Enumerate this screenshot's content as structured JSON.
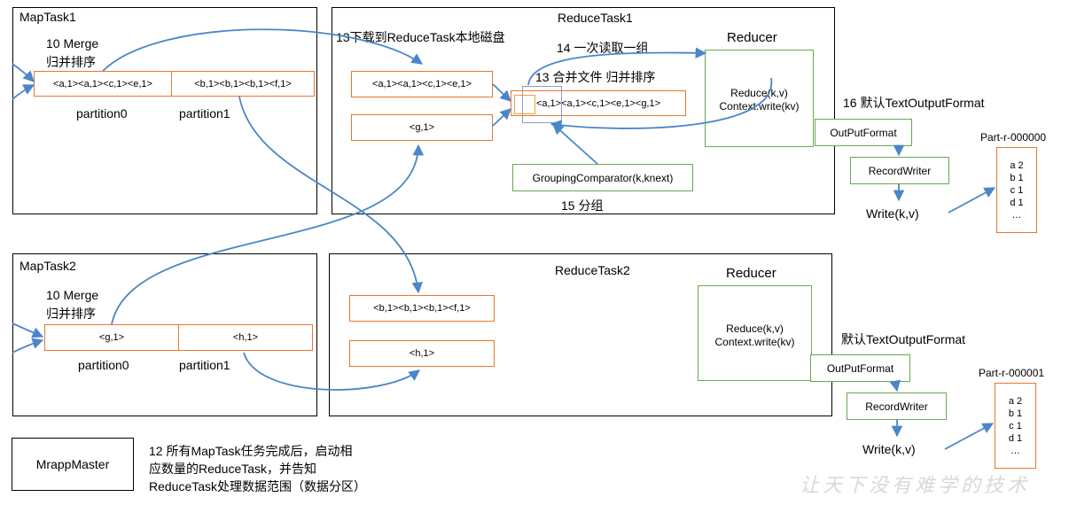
{
  "maptask1": {
    "title": "MapTask1",
    "merge_line1": "10 Merge",
    "merge_line2": "归并排序",
    "partition0_records": "<a,1><a,1><c,1><e,1>",
    "partition1_records": "<b,1><b,1><b,1><f,1>",
    "partition0_label": "partition0",
    "partition1_label": "partition1"
  },
  "maptask2": {
    "title": "MapTask2",
    "merge_line1": "10 Merge",
    "merge_line2": "归并排序",
    "partition0_records": "<g,1>",
    "partition1_records": "<h,1>",
    "partition0_label": "partition0",
    "partition1_label": "partition1"
  },
  "reducetask1": {
    "title": "ReduceTask1",
    "download_label": "13下载到ReduceTask本地磁盘",
    "read_group_label": "14 一次读取一组",
    "merge_label": "13 合并文件 归并排序",
    "input1": "<a,1><a,1><c,1><e,1>",
    "input2": "<g,1>",
    "merged": "<a,1><a,1><c,1><e,1><g,1>",
    "grouping_comparator": "GroupingComparator(k,knext)",
    "group_label": "15 分组",
    "reducer_title": "Reducer",
    "reduce_line1": "Reduce(k,v)",
    "reduce_line2": "Context.write(kv)",
    "output_format_label": "16 默认TextOutputFormat",
    "output_format": "OutPutFormat",
    "record_writer": "RecordWriter",
    "write": "Write(k,v)",
    "file_name": "Part-r-000000",
    "file_lines": [
      "a 2",
      "b 1",
      "c 1",
      "d 1",
      "…"
    ]
  },
  "reducetask2": {
    "title": "ReduceTask2",
    "input1": "<b,1><b,1><b,1><f,1>",
    "input2": "<h,1>",
    "reducer_title": "Reducer",
    "reduce_line1": "Reduce(k,v)",
    "reduce_line2": "Context.write(kv)",
    "output_format_label": "默认TextOutputFormat",
    "output_format": "OutPutFormat",
    "record_writer": "RecordWriter",
    "write": "Write(k,v)",
    "file_name": "Part-r-000001",
    "file_lines": [
      "a 2",
      "b 1",
      "c 1",
      "d 1",
      "…"
    ]
  },
  "master": {
    "title": "MrappMaster",
    "note_line1": "12 所有MapTask任务完成后，启动相",
    "note_line2": "应数量的ReduceTask，并告知",
    "note_line3": "ReduceTask处理数据范围（数据分区）"
  },
  "watermark": "让天下没有难学的技术",
  "colors": {
    "orange": "#e8772e",
    "green": "#6aa84f",
    "arrow": "#4a86c8",
    "grouping": "#8f9dc4"
  }
}
